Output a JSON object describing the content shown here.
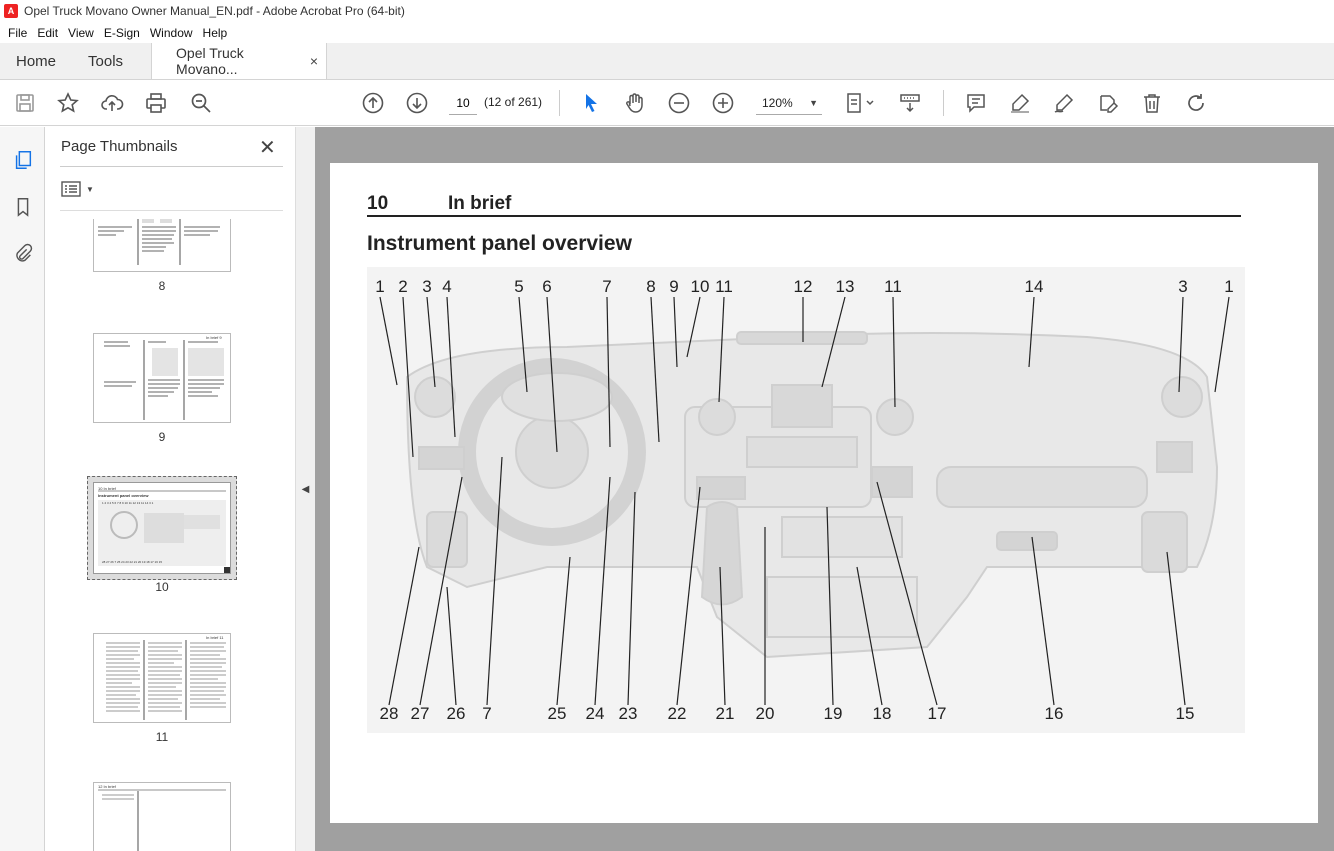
{
  "window": {
    "title": "Opel Truck Movano Owner Manual_EN.pdf - Adobe Acrobat Pro (64-bit)"
  },
  "menu": [
    "File",
    "Edit",
    "View",
    "E-Sign",
    "Window",
    "Help"
  ],
  "tabs": {
    "home": "Home",
    "tools": "Tools",
    "document": "Opel Truck Movano...",
    "close": "×"
  },
  "toolbar": {
    "page_value": "10",
    "page_count": "(12 of 261)",
    "zoom": "120%",
    "icons": [
      "save-icon",
      "bookmark-star-icon",
      "upload-icon",
      "print-icon",
      "find-icon",
      "page-up-icon",
      "page-down-icon",
      "select-arrow-icon",
      "hand-icon",
      "zoom-out-icon",
      "zoom-in-icon",
      "fit-page-icon",
      "scroll-mode-icon",
      "comment-icon",
      "highlight-icon",
      "sign-icon",
      "fill-sign-icon",
      "delete-icon",
      "rotate-icon"
    ]
  },
  "panel": {
    "title": "Page Thumbnails",
    "close": "✕",
    "thumbnails": [
      {
        "label": "8"
      },
      {
        "label": "9"
      },
      {
        "label": "10",
        "selected": true
      },
      {
        "label": "11"
      },
      {
        "label": ""
      }
    ]
  },
  "page": {
    "number": "10",
    "section": "In brief",
    "heading": "Instrument panel overview",
    "callouts_top": [
      "1",
      "2",
      "3",
      "4",
      "5",
      "6",
      "7",
      "8",
      "9",
      "10",
      "11",
      "12",
      "13",
      "11",
      "14",
      "3",
      "1"
    ],
    "callouts_bottom": [
      "28",
      "27",
      "26",
      "7",
      "25",
      "24",
      "23",
      "22",
      "21",
      "20",
      "19",
      "18",
      "17",
      "16",
      "15"
    ]
  }
}
